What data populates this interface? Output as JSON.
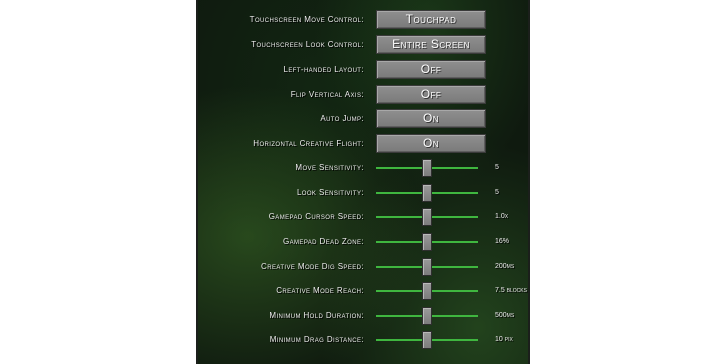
{
  "settings": {
    "buttons": [
      {
        "label": "Touchscreen Move Control:",
        "value": "Touchpad"
      },
      {
        "label": "Touchscreen Look Control:",
        "value": "Entire Screen"
      },
      {
        "label": "Left-handed Layout:",
        "value": "Off"
      },
      {
        "label": "Flip Vertical Axis:",
        "value": "Off"
      },
      {
        "label": "Auto Jump:",
        "value": "On"
      },
      {
        "label": "Horizontal Creative Flight:",
        "value": "On"
      }
    ],
    "sliders": [
      {
        "label": "Move Sensitivity:",
        "value": "5",
        "level": 0.5
      },
      {
        "label": "Look Sensitivity:",
        "value": "5",
        "level": 0.5
      },
      {
        "label": "Gamepad Cursor Speed:",
        "value": "1.0x",
        "level": 0.5
      },
      {
        "label": "Gamepad Dead Zone:",
        "value": "16%",
        "level": 0.5
      },
      {
        "label": "Creative Mode Dig Speed:",
        "value": "200ms",
        "level": 0.5
      },
      {
        "label": "Creative Mode Reach:",
        "value": "7.5 blocks",
        "level": 0.5
      },
      {
        "label": "Minimum Hold Duration:",
        "value": "500ms",
        "level": 0.5
      },
      {
        "label": "Minimum Drag Distance:",
        "value": "10 pix",
        "level": 0.5
      }
    ]
  },
  "colors": {
    "slider_track": "#3fb63f",
    "button_face": "#858585",
    "panel_background": "#0f1a0f"
  }
}
